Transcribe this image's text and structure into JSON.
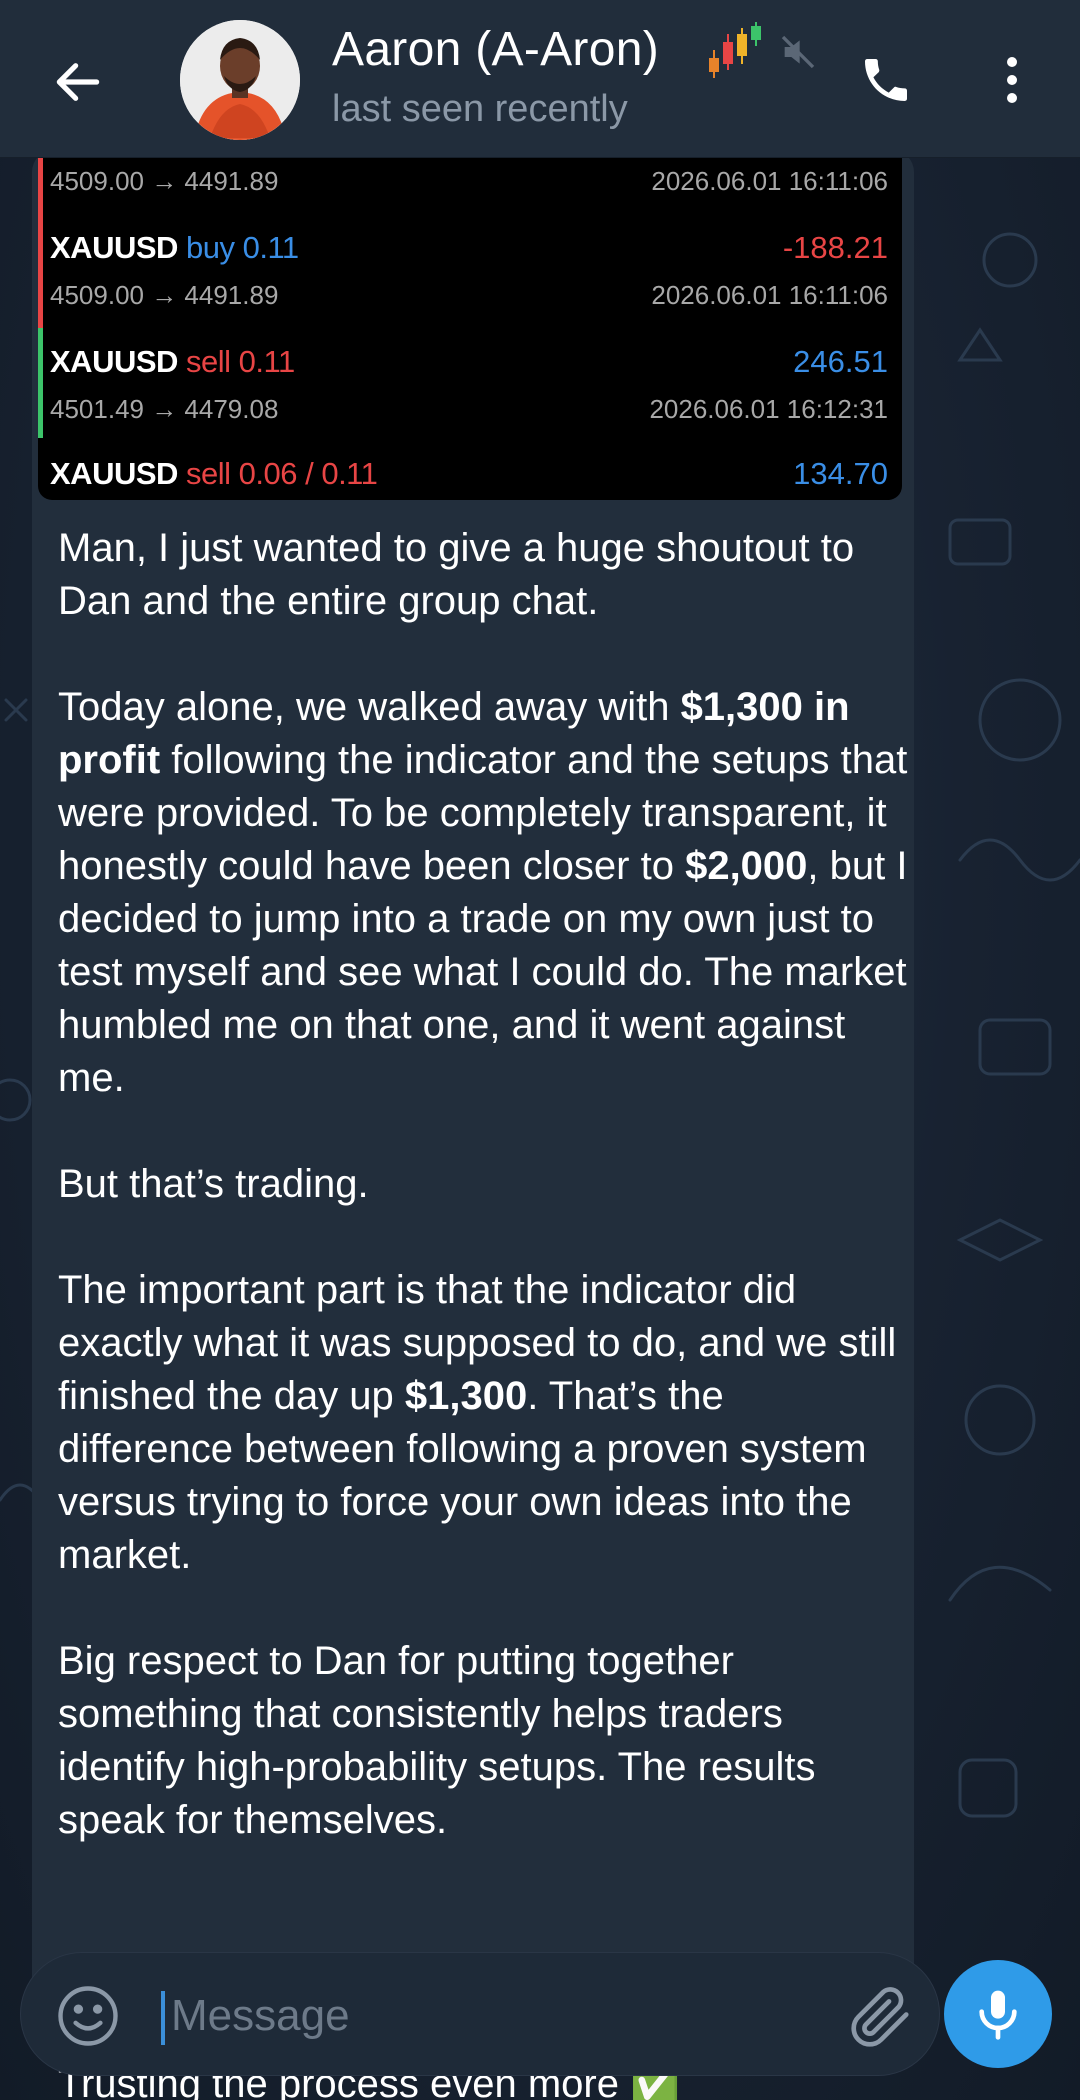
{
  "header": {
    "contact_name": "Aaron (A-Aron)",
    "status": "last seen recently",
    "icons": {
      "back": "arrow-left-icon",
      "emoji_status": "candlestick-chart-icon",
      "muted": "muted-speaker-icon",
      "call": "phone-icon",
      "menu": "more-vertical-icon"
    }
  },
  "trade_screenshot": {
    "top_row": {
      "price": "4509.00 → 4491.89",
      "time": "2026.06.01 16:11:06"
    },
    "trades": [
      {
        "symbol": "XAUUSD",
        "side": "buy 0.11",
        "profit": "-188.21",
        "price": "4509.00 → 4491.89",
        "time": "2026.06.01 16:11:06"
      },
      {
        "symbol": "XAUUSD",
        "side": "sell 0.11",
        "profit": "246.51",
        "price": "4501.49 → 4479.08",
        "time": "2026.06.01 16:12:31"
      },
      {
        "symbol": "XAUUSD",
        "side": "sell 0.06 / 0.11",
        "profit": "134.70"
      }
    ]
  },
  "message": {
    "p1": "Man, I just wanted to give a huge shoutout to Dan and the entire group chat.",
    "p2_a": "Today alone, we walked away with ",
    "p2_bold1": "$1,300 in profit",
    "p2_b": " following the indicator and the setups that were provided. To be completely transparent, it honestly could have been closer to ",
    "p2_bold2": "$2,000",
    "p2_c": ", but I decided to jump into a trade on my own just to test myself and see what I could do. The market humbled me on that one, and it went against me.",
    "p3": "But that’s trading.",
    "p4_a": "The important part is that the indicator did exactly what it was supposed to do, and we still finished the day up ",
    "p4_bold": "$1,300",
    "p4_b": ". That’s the difference between following a proven system versus trying to force your own ideas into the market.",
    "p5": "Big respect to Dan for putting together something that consistently helps traders identify high-probability setups. The results speak for themselves.",
    "peek": "Trusting the process even more ✅"
  },
  "composer": {
    "placeholder": "Message",
    "value": "",
    "icons": {
      "emoji": "emoji-smile-icon",
      "attach": "paperclip-icon",
      "mic": "microphone-icon"
    }
  },
  "colors": {
    "header_bg": "#212d3b",
    "bubble_bg": "#222e3c",
    "accent": "#2f9be8",
    "buy": "#3a8ee6",
    "sell": "#e84545",
    "muted_text": "#8b98a7"
  }
}
